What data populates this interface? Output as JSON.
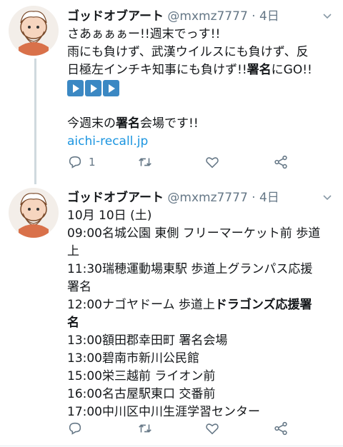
{
  "tweets": [
    {
      "name": "ゴッドオブアート",
      "handle": "@mxmz7777",
      "time": "· 4日",
      "lines": {
        "l1": "さあぁぁぁー!!週末でっす!!",
        "l2": "雨にも負けず、武漢ウイルスにも負けず、反",
        "l3a": "日極左インチキ知事にも負けず!!",
        "l3b": "署名",
        "l3c": "にGO!!",
        "l4a": "今週末の",
        "l4b": "署名",
        "l4c": "会場です!!",
        "link": "aichi-recall.jp"
      },
      "reply_count": "1",
      "retweet_count": "",
      "like_count": ""
    },
    {
      "name": "ゴッドオブアート",
      "handle": "@mxmz7777",
      "time": "· 4日",
      "lines": {
        "l1": "10月 10日 (土)",
        "l2": "09:00名城公園 東側 フリーマーケット前 歩道",
        "l3": "上",
        "l4": "11:30瑞穂運動場東駅 歩道上グランパス応援",
        "l5": "署名",
        "l6a": "12:00ナゴヤドーム 歩道上",
        "l6b": "ドラゴンズ応援署",
        "l7": "名",
        "l8": "13:00額田郡幸田町 署名会場",
        "l9": "13:00碧南市新川公民館",
        "l10": "15:00栄三越前 ライオン前",
        "l11": "16:00名古屋駅東口 交番前",
        "l12": "17:00中川区中川生涯学習センター"
      },
      "reply_count": "",
      "retweet_count": "",
      "like_count": ""
    }
  ],
  "colors": {
    "text": "#14171a",
    "muted": "#657786",
    "link": "#1b95e0",
    "emoji_button": "#3b88c3"
  },
  "icons": [
    "reply-icon",
    "retweet-icon",
    "like-icon",
    "share-icon",
    "caret-down-icon",
    "play-button-emoji"
  ]
}
